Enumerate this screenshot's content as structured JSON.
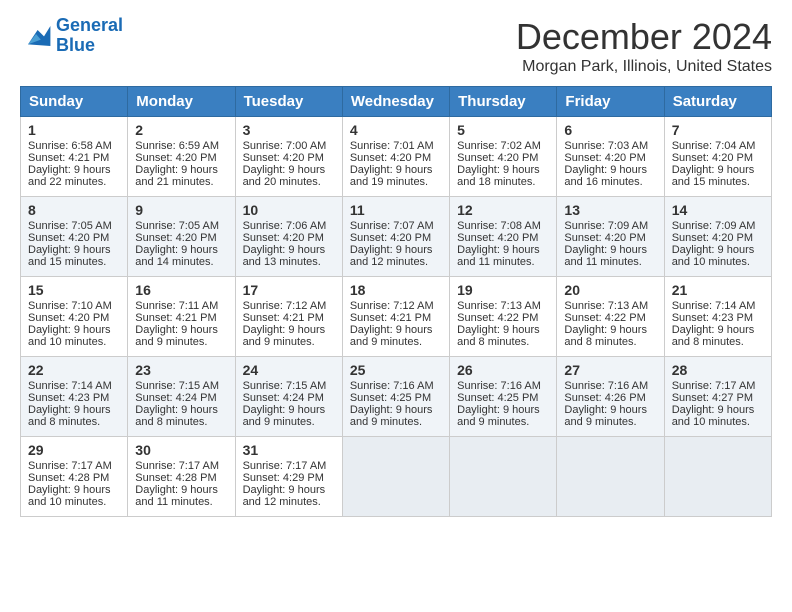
{
  "logo": {
    "line1": "General",
    "line2": "Blue"
  },
  "title": "December 2024",
  "subtitle": "Morgan Park, Illinois, United States",
  "days_of_week": [
    "Sunday",
    "Monday",
    "Tuesday",
    "Wednesday",
    "Thursday",
    "Friday",
    "Saturday"
  ],
  "weeks": [
    [
      {
        "day": "1",
        "sunrise": "Sunrise: 6:58 AM",
        "sunset": "Sunset: 4:21 PM",
        "daylight": "Daylight: 9 hours and 22 minutes."
      },
      {
        "day": "2",
        "sunrise": "Sunrise: 6:59 AM",
        "sunset": "Sunset: 4:20 PM",
        "daylight": "Daylight: 9 hours and 21 minutes."
      },
      {
        "day": "3",
        "sunrise": "Sunrise: 7:00 AM",
        "sunset": "Sunset: 4:20 PM",
        "daylight": "Daylight: 9 hours and 20 minutes."
      },
      {
        "day": "4",
        "sunrise": "Sunrise: 7:01 AM",
        "sunset": "Sunset: 4:20 PM",
        "daylight": "Daylight: 9 hours and 19 minutes."
      },
      {
        "day": "5",
        "sunrise": "Sunrise: 7:02 AM",
        "sunset": "Sunset: 4:20 PM",
        "daylight": "Daylight: 9 hours and 18 minutes."
      },
      {
        "day": "6",
        "sunrise": "Sunrise: 7:03 AM",
        "sunset": "Sunset: 4:20 PM",
        "daylight": "Daylight: 9 hours and 16 minutes."
      },
      {
        "day": "7",
        "sunrise": "Sunrise: 7:04 AM",
        "sunset": "Sunset: 4:20 PM",
        "daylight": "Daylight: 9 hours and 15 minutes."
      }
    ],
    [
      {
        "day": "8",
        "sunrise": "Sunrise: 7:05 AM",
        "sunset": "Sunset: 4:20 PM",
        "daylight": "Daylight: 9 hours and 15 minutes."
      },
      {
        "day": "9",
        "sunrise": "Sunrise: 7:05 AM",
        "sunset": "Sunset: 4:20 PM",
        "daylight": "Daylight: 9 hours and 14 minutes."
      },
      {
        "day": "10",
        "sunrise": "Sunrise: 7:06 AM",
        "sunset": "Sunset: 4:20 PM",
        "daylight": "Daylight: 9 hours and 13 minutes."
      },
      {
        "day": "11",
        "sunrise": "Sunrise: 7:07 AM",
        "sunset": "Sunset: 4:20 PM",
        "daylight": "Daylight: 9 hours and 12 minutes."
      },
      {
        "day": "12",
        "sunrise": "Sunrise: 7:08 AM",
        "sunset": "Sunset: 4:20 PM",
        "daylight": "Daylight: 9 hours and 11 minutes."
      },
      {
        "day": "13",
        "sunrise": "Sunrise: 7:09 AM",
        "sunset": "Sunset: 4:20 PM",
        "daylight": "Daylight: 9 hours and 11 minutes."
      },
      {
        "day": "14",
        "sunrise": "Sunrise: 7:09 AM",
        "sunset": "Sunset: 4:20 PM",
        "daylight": "Daylight: 9 hours and 10 minutes."
      }
    ],
    [
      {
        "day": "15",
        "sunrise": "Sunrise: 7:10 AM",
        "sunset": "Sunset: 4:20 PM",
        "daylight": "Daylight: 9 hours and 10 minutes."
      },
      {
        "day": "16",
        "sunrise": "Sunrise: 7:11 AM",
        "sunset": "Sunset: 4:21 PM",
        "daylight": "Daylight: 9 hours and 9 minutes."
      },
      {
        "day": "17",
        "sunrise": "Sunrise: 7:12 AM",
        "sunset": "Sunset: 4:21 PM",
        "daylight": "Daylight: 9 hours and 9 minutes."
      },
      {
        "day": "18",
        "sunrise": "Sunrise: 7:12 AM",
        "sunset": "Sunset: 4:21 PM",
        "daylight": "Daylight: 9 hours and 9 minutes."
      },
      {
        "day": "19",
        "sunrise": "Sunrise: 7:13 AM",
        "sunset": "Sunset: 4:22 PM",
        "daylight": "Daylight: 9 hours and 8 minutes."
      },
      {
        "day": "20",
        "sunrise": "Sunrise: 7:13 AM",
        "sunset": "Sunset: 4:22 PM",
        "daylight": "Daylight: 9 hours and 8 minutes."
      },
      {
        "day": "21",
        "sunrise": "Sunrise: 7:14 AM",
        "sunset": "Sunset: 4:23 PM",
        "daylight": "Daylight: 9 hours and 8 minutes."
      }
    ],
    [
      {
        "day": "22",
        "sunrise": "Sunrise: 7:14 AM",
        "sunset": "Sunset: 4:23 PM",
        "daylight": "Daylight: 9 hours and 8 minutes."
      },
      {
        "day": "23",
        "sunrise": "Sunrise: 7:15 AM",
        "sunset": "Sunset: 4:24 PM",
        "daylight": "Daylight: 9 hours and 8 minutes."
      },
      {
        "day": "24",
        "sunrise": "Sunrise: 7:15 AM",
        "sunset": "Sunset: 4:24 PM",
        "daylight": "Daylight: 9 hours and 9 minutes."
      },
      {
        "day": "25",
        "sunrise": "Sunrise: 7:16 AM",
        "sunset": "Sunset: 4:25 PM",
        "daylight": "Daylight: 9 hours and 9 minutes."
      },
      {
        "day": "26",
        "sunrise": "Sunrise: 7:16 AM",
        "sunset": "Sunset: 4:25 PM",
        "daylight": "Daylight: 9 hours and 9 minutes."
      },
      {
        "day": "27",
        "sunrise": "Sunrise: 7:16 AM",
        "sunset": "Sunset: 4:26 PM",
        "daylight": "Daylight: 9 hours and 9 minutes."
      },
      {
        "day": "28",
        "sunrise": "Sunrise: 7:17 AM",
        "sunset": "Sunset: 4:27 PM",
        "daylight": "Daylight: 9 hours and 10 minutes."
      }
    ],
    [
      {
        "day": "29",
        "sunrise": "Sunrise: 7:17 AM",
        "sunset": "Sunset: 4:28 PM",
        "daylight": "Daylight: 9 hours and 10 minutes."
      },
      {
        "day": "30",
        "sunrise": "Sunrise: 7:17 AM",
        "sunset": "Sunset: 4:28 PM",
        "daylight": "Daylight: 9 hours and 11 minutes."
      },
      {
        "day": "31",
        "sunrise": "Sunrise: 7:17 AM",
        "sunset": "Sunset: 4:29 PM",
        "daylight": "Daylight: 9 hours and 12 minutes."
      },
      null,
      null,
      null,
      null
    ]
  ]
}
